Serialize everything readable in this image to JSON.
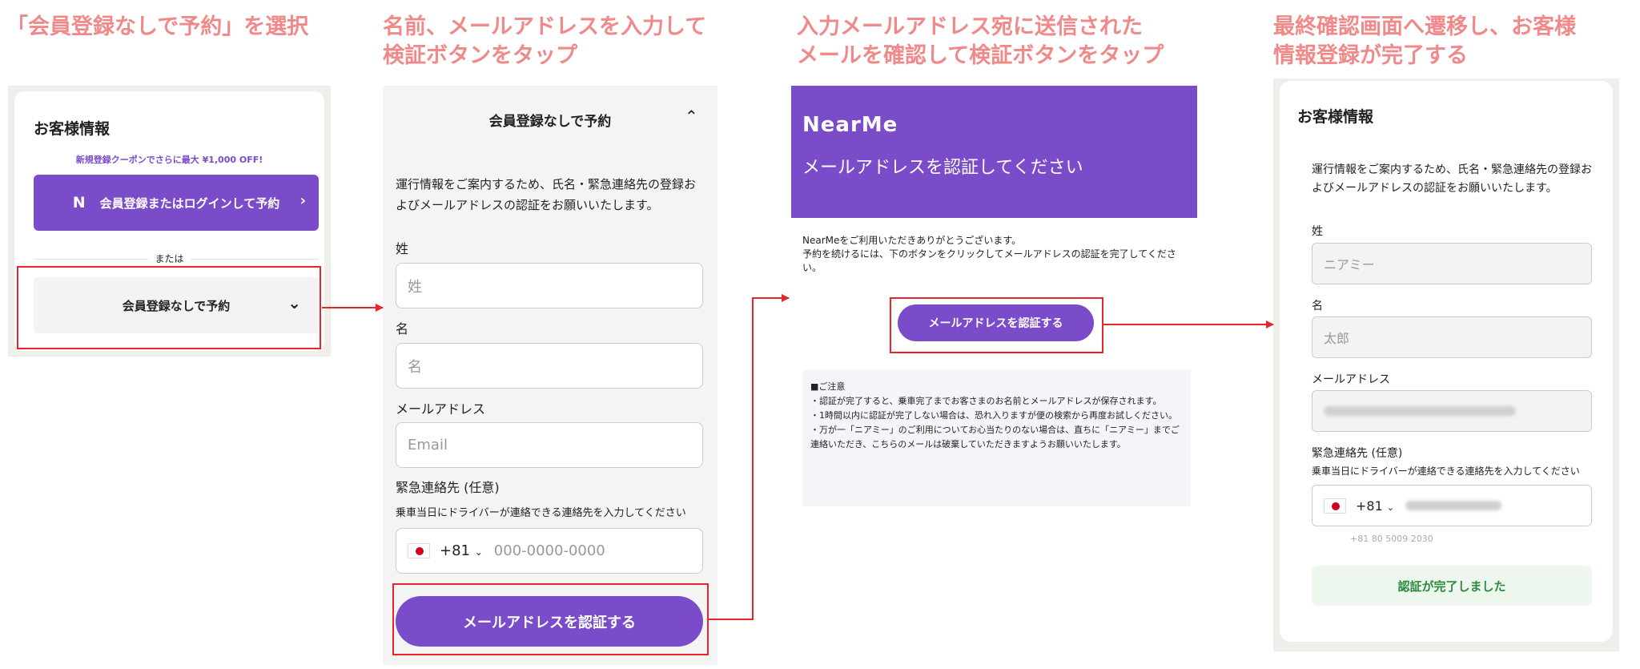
{
  "steps": {
    "s1": "「会員登録なしで予約」を選択",
    "s2": "名前、メールアドレスを入力して\n検証ボタンをタップ",
    "s3": "入力メールアドレス宛に送信された\nメールを確認して検証ボタンをタップ",
    "s4": "最終確認画面へ遷移し、お客様\n情報登録が完了する"
  },
  "panel1": {
    "title": "お客様情報",
    "promo": "新規登録クーポンでさらに最大 ¥1,000 OFF!",
    "login_logo": "N",
    "login_label": "会員登録またはログインして予約",
    "or": "または",
    "guest_label": "会員登録なしで予約"
  },
  "panel2": {
    "header": "会員登録なしで予約",
    "desc": "運行情報をご案内するため、氏名・緊急連絡先の登録およびメールアドレスの認証をお願いいたします。",
    "last_label": "姓",
    "last_placeholder": "姓",
    "first_label": "名",
    "first_placeholder": "名",
    "email_label": "メールアドレス",
    "email_placeholder": "Email",
    "emergency_label": "緊急連絡先 (任意)",
    "emergency_sub": "乗車当日にドライバーが連絡できる連絡先を入力してください",
    "country_code": "+81",
    "phone_placeholder": "000-0000-0000",
    "verify_button": "メールアドレスを認証する"
  },
  "panel3": {
    "logo": "NearMe",
    "heading": "メールアドレスを認証してください",
    "greeting_1": "NearMeをご利用いただきありがとうございます。",
    "greeting_2": "予約を続けるには、下のボタンをクリックしてメールアドレスの認証を完了してください。",
    "verify_button": "メールアドレスを認証する",
    "note_title": "■ご注意",
    "note_1": "・認証が完了すると、乗車完了までお客さまのお名前とメールアドレスが保存されます。",
    "note_2": "・1時間以内に認証が完了しない場合は、恐れ入りますが便の検索から再度お試しください。",
    "note_3": "・万が一「ニアミー」のご利用についてお心当たりのない場合は、直ちに「ニアミー」までご連絡いただき、こちらのメールは破棄していただきますようお願いいたします。"
  },
  "panel4": {
    "title": "お客様情報",
    "desc": "運行情報をご案内するため、氏名・緊急連絡先の登録およびメールアドレスの認証をお願いいたします。",
    "last_label": "姓",
    "last_value": "ニアミー",
    "first_label": "名",
    "first_value": "太郎",
    "email_label": "メールアドレス",
    "emergency_label": "緊急連絡先 (任意)",
    "emergency_sub": "乗車当日にドライバーが連絡できる連絡先を入力してください",
    "country_code": "+81",
    "phone_hint": "+81 80 5009 2030",
    "done_label": "認証が完了しました"
  }
}
